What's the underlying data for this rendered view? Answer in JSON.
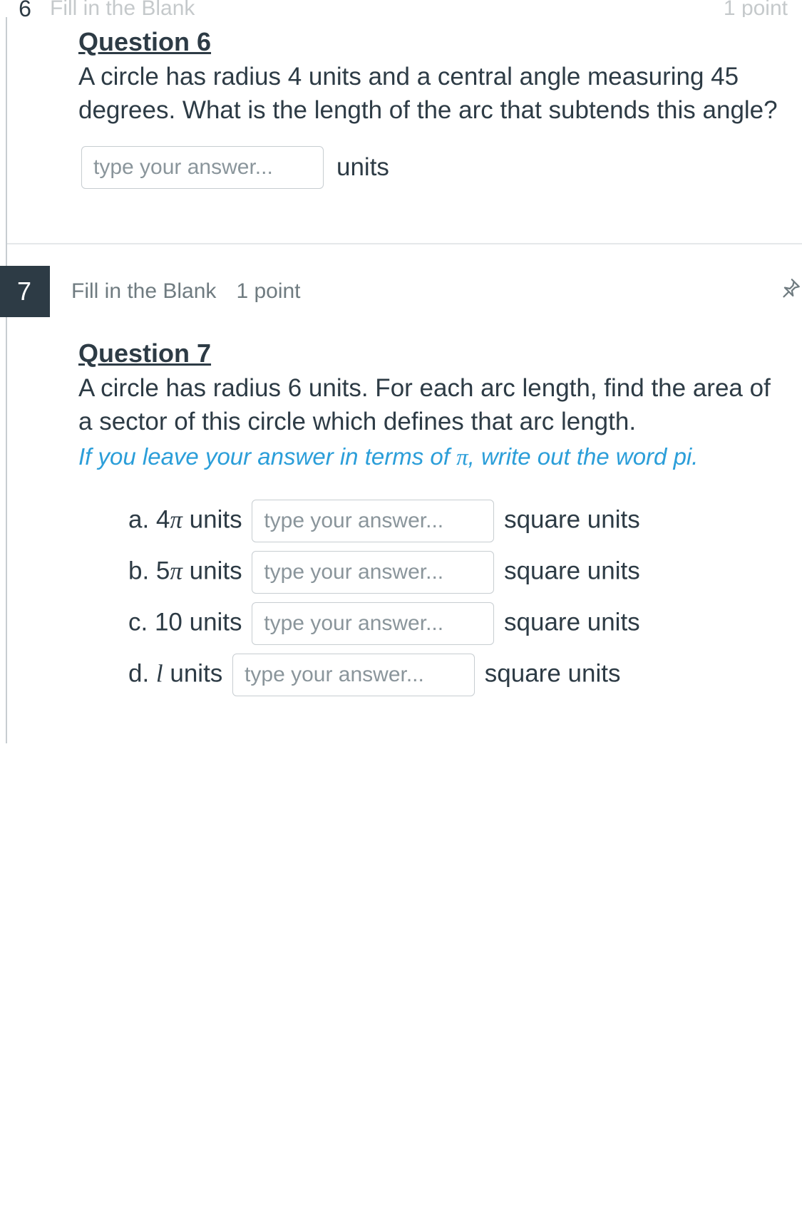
{
  "top": {
    "number": "6",
    "type": "Fill in the Blank",
    "points": "1 point"
  },
  "q6": {
    "title": "Question 6",
    "text": "A circle has radius 4 units and a central angle measuring 45 degrees. What is the length of the arc that subtends this angle?",
    "placeholder": "type your answer...",
    "unit": "units"
  },
  "q7_header": {
    "number": "7",
    "type": "Fill in the Blank",
    "points": "1 point"
  },
  "q7": {
    "title": "Question 7",
    "text": "A circle has radius 6 units. For each arc length, find the area of a sector of this circle which defines that arc length.",
    "hint_prefix": "If you leave your answer in terms of ",
    "hint_pi": "π",
    "hint_suffix": ", write out the word pi.",
    "placeholder": "type your answer...",
    "parts": {
      "a": {
        "label_prefix": "a. 4",
        "label_pi": "π",
        "label_suffix": " units",
        "unit": "square units"
      },
      "b": {
        "label_prefix": "b. 5",
        "label_pi": "π",
        "label_suffix": " units",
        "unit": "square units"
      },
      "c": {
        "label": "c. 10 units",
        "unit": "square units"
      },
      "d": {
        "label_prefix": "d. ",
        "label_var": "l",
        "label_suffix": " units",
        "unit": "square units"
      }
    }
  }
}
